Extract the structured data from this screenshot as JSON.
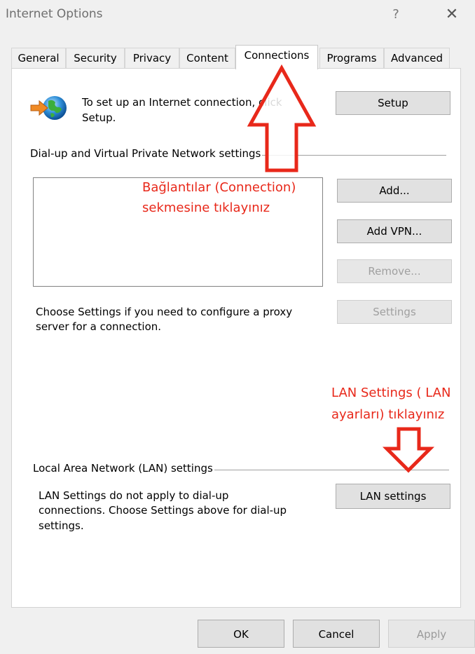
{
  "window": {
    "title": "Internet Options",
    "help_symbol": "?",
    "close_symbol": "✕"
  },
  "tabs": [
    {
      "label": "General"
    },
    {
      "label": "Security"
    },
    {
      "label": "Privacy"
    },
    {
      "label": "Content"
    },
    {
      "label": "Connections",
      "active": true
    },
    {
      "label": "Programs"
    },
    {
      "label": "Advanced"
    }
  ],
  "setup_section": {
    "icon": "globe-connection-icon",
    "text_line1": "To set up an Internet connection, click",
    "text_line2": "Setup.",
    "setup_button": "Setup"
  },
  "vpn_section": {
    "group_label": "Dial-up and Virtual Private Network settings",
    "add_button": "Add...",
    "add_vpn_button": "Add VPN...",
    "remove_button": "Remove...",
    "settings_button": "Settings",
    "proxy_text_line1": "Choose Settings if you need to configure a proxy",
    "proxy_text_line2": "server for a connection."
  },
  "lan_section": {
    "group_label": "Local Area Network (LAN) settings",
    "text_line1": "LAN Settings do not apply to dial-up",
    "text_line2": "connections. Choose Settings above for dial-up",
    "text_line3": "settings.",
    "lan_button": "LAN settings"
  },
  "annotations": {
    "connections_note_line1": "Bağlantılar (Connection)",
    "connections_note_line2": "sekmesine tıklayınız",
    "lan_note_line1": "LAN Settings ( LAN",
    "lan_note_line2": "ayarları) tıklayınız",
    "color": "#e8281a"
  },
  "footer": {
    "ok": "OK",
    "cancel": "Cancel",
    "apply": "Apply"
  }
}
